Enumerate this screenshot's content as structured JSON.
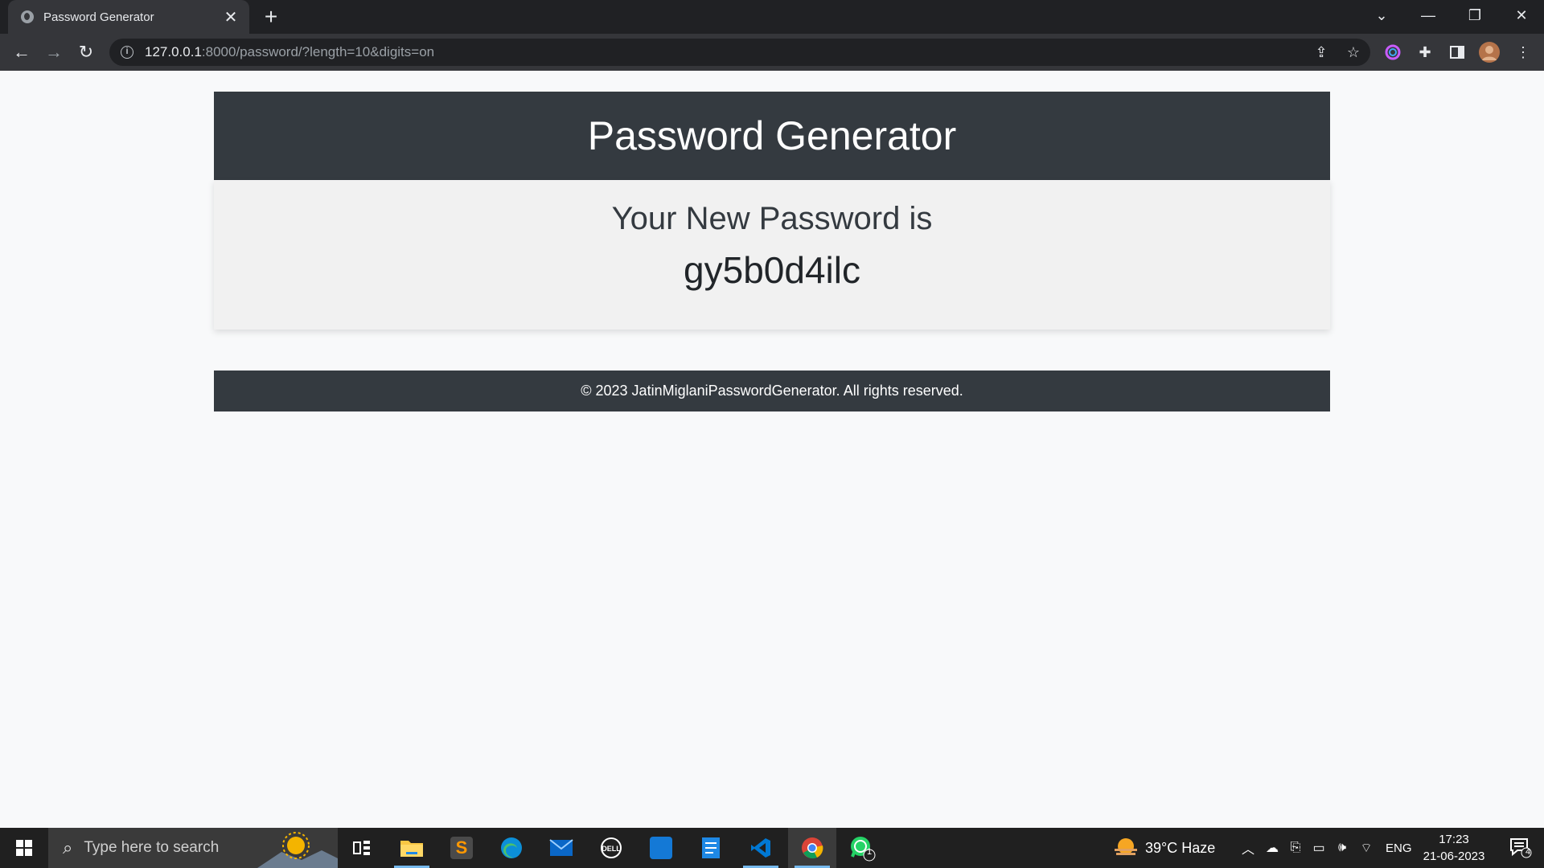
{
  "browser": {
    "tab_title": "Password Generator",
    "tab_close": "✕",
    "new_tab": "+",
    "url_host": "127.0.0.1",
    "url_rest": ":8000/password/?length=10&digits=on"
  },
  "page": {
    "header_title": "Password Generator",
    "subtitle": "Your New Password is",
    "password": "gy5b0d4ilc",
    "footer": "© 2023 JatinMiglaniPasswordGenerator. All rights reserved."
  },
  "taskbar": {
    "search_placeholder": "Type here to search",
    "weather": "39°C  Haze",
    "language": "ENG",
    "time": "17:23",
    "date": "21-06-2023",
    "whatsapp_badge": "1",
    "notification_count": "4"
  },
  "colors": {
    "header_bg": "#343a40",
    "card_bg": "#f1f1f1",
    "page_bg": "#f8f9fa",
    "vscode": "#0078d4",
    "edge": "#0c8fd8",
    "whatsapp": "#25d366",
    "sublime": "#ff9800"
  }
}
